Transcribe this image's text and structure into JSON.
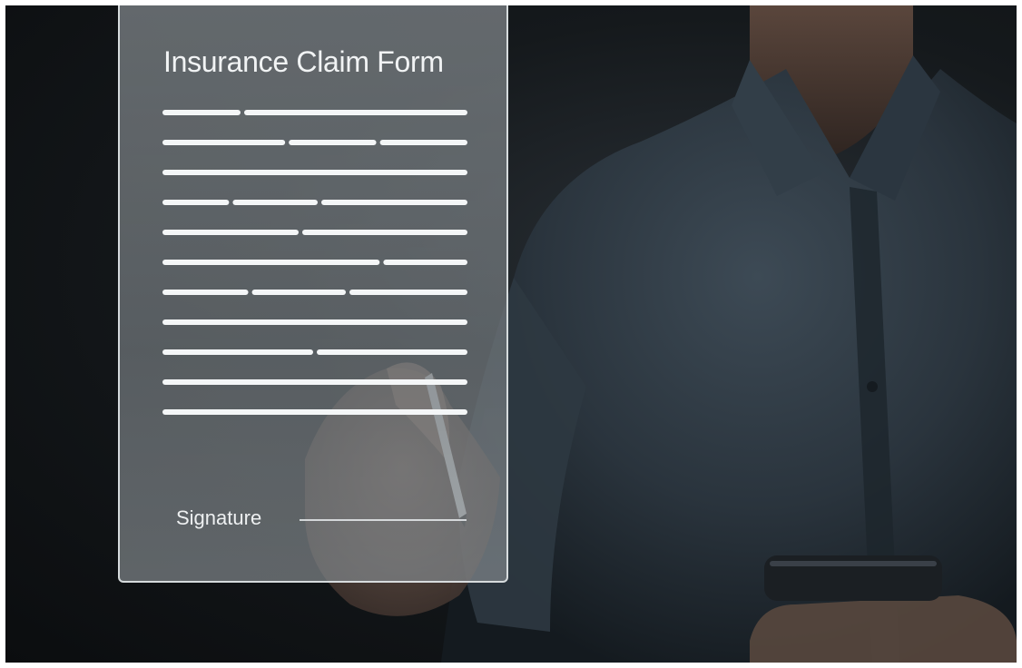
{
  "form": {
    "title": "Insurance Claim Form",
    "signature_label": "Signature",
    "placeholder_line_rows": [
      [
        1,
        3
      ],
      [
        2,
        1.4,
        1.4
      ],
      [
        1
      ],
      [
        1,
        1.3,
        2.3
      ],
      [
        1.8,
        2.2
      ],
      [
        3.5,
        1.3
      ],
      [
        1,
        1.1,
        1.4
      ],
      [
        1
      ],
      [
        2,
        2
      ],
      [
        1
      ],
      [
        1
      ]
    ]
  },
  "colors": {
    "panel_border": "#ebf0f2",
    "text": "#f1f3f4",
    "placeholder_lines": "#f4f6f7",
    "shirt": "#2e3a44",
    "background": "#0b0d0f"
  }
}
